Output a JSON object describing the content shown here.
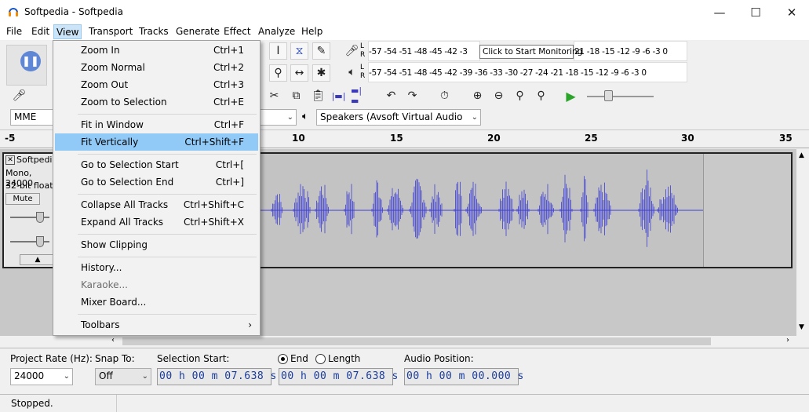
{
  "window": {
    "title": "Softpedia - Softpedia",
    "controls": {
      "minimize": "—",
      "maximize": "☐",
      "close": "✕"
    }
  },
  "menubar": [
    "File",
    "Edit",
    "View",
    "Transport",
    "Tracks",
    "Generate",
    "Effect",
    "Analyze",
    "Help"
  ],
  "view_menu": {
    "items": [
      {
        "label": "Zoom In",
        "shortcut": "Ctrl+1"
      },
      {
        "label": "Zoom Normal",
        "shortcut": "Ctrl+2"
      },
      {
        "label": "Zoom Out",
        "shortcut": "Ctrl+3"
      },
      {
        "label": "Zoom to Selection",
        "shortcut": "Ctrl+E"
      },
      {
        "label": "Fit in Window",
        "shortcut": "Ctrl+F"
      },
      {
        "label": "Fit Vertically",
        "shortcut": "Ctrl+Shift+F"
      },
      {
        "label": "Go to Selection Start",
        "shortcut": "Ctrl+["
      },
      {
        "label": "Go to Selection End",
        "shortcut": "Ctrl+]"
      },
      {
        "label": "Collapse All Tracks",
        "shortcut": "Ctrl+Shift+C"
      },
      {
        "label": "Expand All Tracks",
        "shortcut": "Ctrl+Shift+X"
      },
      {
        "label": "Show Clipping",
        "shortcut": ""
      },
      {
        "label": "History...",
        "shortcut": ""
      },
      {
        "label": "Karaoke...",
        "shortcut": ""
      },
      {
        "label": "Mixer Board...",
        "shortcut": ""
      },
      {
        "label": "Toolbars",
        "shortcut": "›"
      }
    ]
  },
  "tooltip": "Click to Start Monitoring",
  "meters": {
    "record_scale": "-57 -54 -51 -48 -45 -42 -3",
    "record_scale_right": "21 -18 -15 -12 -9 -6 -3 0",
    "play_scale": "-57 -54 -51 -48 -45 -42 -39 -36 -33 -30 -27 -24 -21 -18 -15 -12 -9 -6 -3 0",
    "channel_l": "L",
    "channel_r": "R"
  },
  "device": {
    "host": "MME",
    "output": "Speakers (Avsoft Virtual Audio"
  },
  "ruler": [
    "-5",
    "10",
    "15",
    "20",
    "25",
    "30",
    "35"
  ],
  "track": {
    "name": "Softpedia",
    "info1": "Mono, 24000",
    "info2": "32-bit float",
    "mute": "Mute"
  },
  "bottom": {
    "project_rate_label": "Project Rate (Hz):",
    "project_rate": "24000",
    "snap_label": "Snap To:",
    "snap_value": "Off",
    "selection_start_label": "Selection Start:",
    "end_label": "End",
    "length_label": "Length",
    "audio_position_label": "Audio Position:",
    "selection_start": "00 h 00 m 07.638 s",
    "selection_end": "00 h 00 m 07.638 s",
    "audio_position": "00 h 00 m 00.000 s"
  },
  "status": "Stopped.",
  "colors": {
    "wave": "#3f3fd3",
    "menu_highlight": "#91c9f7",
    "timecode": "#1a3c9e"
  }
}
